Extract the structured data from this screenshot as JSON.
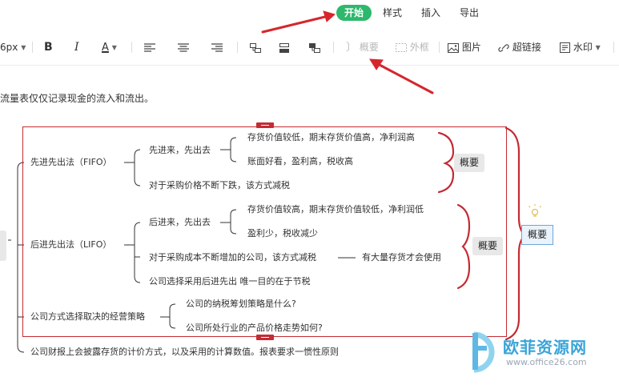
{
  "tabs": [
    {
      "label": "开始",
      "active": true
    },
    {
      "label": "样式",
      "active": false
    },
    {
      "label": "插入",
      "active": false
    },
    {
      "label": "导出",
      "active": false
    }
  ],
  "toolbar": {
    "font_size": "6px",
    "bold": "B",
    "italic": "I",
    "font_color": "A",
    "summary_label": "概要",
    "frame_label": "外框",
    "image_label": "图片",
    "hyperlink_label": "超链接",
    "watermark_label": "水印"
  },
  "canvas": {
    "intro_text": "流量表仅仅记录现金的流入和流出。",
    "nodes": {
      "fifo": "先进先出法（FIFO）",
      "fifo_first": "先进来，先出去",
      "fifo_leaf1": "存货价值较低，期末存货价值高，净利润高",
      "fifo_leaf2": "账面好看，盈利高，税收高",
      "fifo_rising": "对于采购价格不断下跌，该方式减税",
      "lifo": "后进先出法（LIFO）",
      "lifo_first": "后进来，先出去",
      "lifo_leaf1": "存货价值较高，期末存货价值较低，净利润低",
      "lifo_leaf2": "盈利少，税收减少",
      "lifo_rising": "对于采购成本不断增加的公司，该方式减税",
      "lifo_rising_note": "有大量存货才会使用",
      "lifo_company": "公司选择采用后进先出 唯一目的在于节税",
      "strategy": "公司方式选择取决的经营策略",
      "strategy_q1": "公司的纳税筹划策略是什么?",
      "strategy_q2": "公司所处行业的产品价格走势如何?",
      "disclosure": "公司财报上会披露存货的计价方式，以及采用的计算数值。报表要求一惯性原则"
    },
    "summary1": "概要",
    "summary2": "概要",
    "summary_main": "概要"
  },
  "watermark": {
    "brand": "欧菲资源网",
    "url": "www.office26.com"
  },
  "colors": {
    "accent_green": "#2eb86c",
    "frame_red": "#c42b33",
    "arrow_red": "#d6262c",
    "selection_blue": "#6ea6d8"
  }
}
